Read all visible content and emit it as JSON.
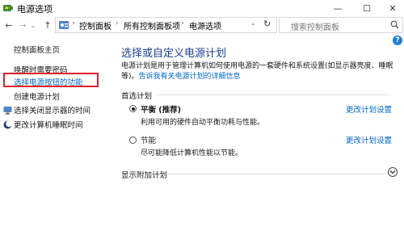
{
  "window": {
    "title": "电源选项",
    "icon": "power-options-icon",
    "controls": {
      "minimize": "—",
      "maximize": "☐",
      "close": "✕"
    }
  },
  "nav": {
    "back": "←",
    "forward": "→",
    "history": "⌄",
    "up": "↑",
    "address": {
      "icon": "control-panel-icon",
      "sep": "›",
      "crumbs": [
        "控制面板",
        "所有控制面板项",
        "电源选项"
      ],
      "dropdown": "⌄",
      "refresh": "↻"
    },
    "search": {
      "placeholder": "搜索控制面板"
    }
  },
  "sidebar": {
    "items": [
      {
        "label": "控制面板主页"
      },
      {
        "label": "唤醒时需要密码"
      },
      {
        "label": "选择电源按钮的功能"
      },
      {
        "label": "创建电源计划"
      },
      {
        "label": "选择关闭显示器的时间",
        "icon": "display-icon"
      },
      {
        "label": "更改计算机睡眠时间",
        "icon": "moon-icon"
      }
    ],
    "highlighted_index": 2,
    "highlight_color": "#e0202a"
  },
  "main": {
    "help": "?",
    "heading": "选择或自定义电源计划",
    "desc_text": "电源计划是用于管理计算机如何使用电源的一套硬件和系统设置(如显示器亮度、睡眠等)。",
    "desc_link": "告诉我有关电源计划的详细信息",
    "section_title": "首选计划",
    "plans": [
      {
        "name": "平衡 (推荐)",
        "desc": "利用可用的硬件自动平衡功耗与性能。",
        "link": "更改计划设置",
        "selected": true
      },
      {
        "name": "节能",
        "desc": "尽可能降低计算机性能以节能。",
        "link": "更改计划设置",
        "selected": false
      }
    ],
    "expander": {
      "label": "显示附加计划",
      "icon": "chevron-down-icon"
    }
  },
  "colors": {
    "heading": "#1b3d8f",
    "link": "#0066cc",
    "accent": "#1c7fd6"
  }
}
